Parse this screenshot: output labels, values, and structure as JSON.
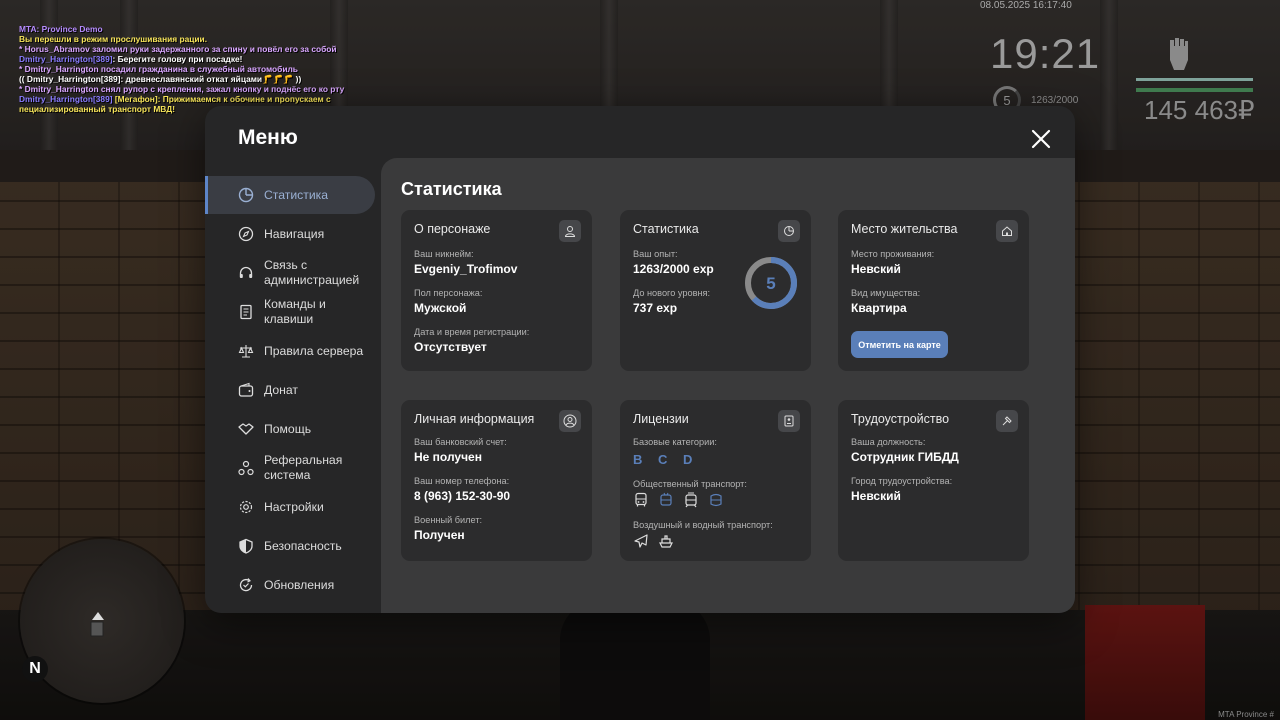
{
  "chat": {
    "lines": [
      {
        "name": "",
        "text": "MTA: Province Demo",
        "color": "#b68cff"
      },
      {
        "name": "",
        "text": "Вы перешли в режим прослушивания рации.",
        "color": "#f5e35a"
      },
      {
        "name": "",
        "text": " * Horus_Abramov заломил руки задержанного за спину и повёл его за собой",
        "color": "#d9a6ff"
      },
      {
        "name": "Dmitry_Harrington[389]",
        "text": ": Берегите голову при посадке!",
        "color": "#ffffff"
      },
      {
        "name": "",
        "text": " * Dmitry_Harrington посадил гражданина в служебный автомобиль",
        "color": "#d9a6ff"
      },
      {
        "name": "",
        "text": "(( Dmitry_Harrington[389]: древнеславянский откат яйцами🦵🦵🦵 ))",
        "color": "#ffffff"
      },
      {
        "name": "",
        "text": " * Dmitry_Harrington снял рупор с крепления, зажал кнопку и поднёс его ко рту",
        "color": "#d9a6ff"
      },
      {
        "name": "Dmitry_Harrington[389]",
        "text": " [Мегафон]: Прижимаемся к обочине и пропускаем с",
        "color": "#f5e35a"
      },
      {
        "name": "",
        "text": "пециализированный транспорт МВД!",
        "color": "#f5e35a"
      }
    ]
  },
  "hud": {
    "date": "08.05.2025 16:17:40",
    "time": "19:21",
    "level": "5",
    "exp": "1263/2000",
    "money": "145 463₽",
    "compass": "N",
    "watermark": "MTA Province #"
  },
  "menu": {
    "title": "Меню",
    "close_icon": "close-icon",
    "content_title": "Статистика",
    "sidebar": [
      {
        "label": "Статистика",
        "icon": "pie-chart-icon",
        "active": true
      },
      {
        "label": "Навигация",
        "icon": "compass-icon"
      },
      {
        "label": "Связь с администрацией",
        "icon": "headset-icon"
      },
      {
        "label": "Команды и клавиши",
        "icon": "document-icon"
      },
      {
        "label": "Правила сервера",
        "icon": "scales-icon"
      },
      {
        "label": "Донат",
        "icon": "wallet-icon"
      },
      {
        "label": "Помощь",
        "icon": "handshake-icon"
      },
      {
        "label": "Реферальная система",
        "icon": "referral-icon"
      },
      {
        "label": "Настройки",
        "icon": "gear-icon"
      },
      {
        "label": "Безопасность",
        "icon": "shield-icon"
      },
      {
        "label": "Обновления",
        "icon": "refresh-icon"
      }
    ]
  },
  "cards": {
    "character": {
      "title": "О персонаже",
      "nickname_label": "Ваш никнейм:",
      "nickname": "Evgeniy_Trofimov",
      "gender_label": "Пол персонажа:",
      "gender": "Мужской",
      "reg_label": "Дата и время регистрации:",
      "reg": "Отсутствует"
    },
    "stats": {
      "title": "Статистика",
      "exp_label": "Ваш опыт:",
      "exp": "1263/2000 exp",
      "next_label": "До нового уровня:",
      "next": "737 exp",
      "level": "5",
      "level_progress": 0.6315
    },
    "residence": {
      "title": "Место жительства",
      "place_label": "Место проживания:",
      "place": "Невский",
      "property_label": "Вид имущества:",
      "property": "Квартира",
      "map_button": "Отметить на карте"
    },
    "personal": {
      "title": "Личная информация",
      "bank_label": "Ваш банковский счет:",
      "bank": "Не получен",
      "phone_label": "Ваш номер телефона:",
      "phone": "8 (963) 152-30-90",
      "military_label": "Военный билет:",
      "military": "Получен"
    },
    "licenses": {
      "title": "Лицензии",
      "basic_label": "Базовые категории:",
      "basic": "B C D",
      "public_label": "Общественный транспорт:",
      "public_icons": [
        "bus-icon",
        "trolleybus-icon",
        "tram-icon",
        "metro-icon"
      ],
      "air_label": "Воздушный и водный транспорт:",
      "air_icons": [
        "airplane-icon",
        "ship-icon"
      ]
    },
    "job": {
      "title": "Трудоустройство",
      "position_label": "Ваша должность:",
      "position": "Сотрудник ГИБДД",
      "city_label": "Город трудоустройства:",
      "city": "Невский"
    }
  },
  "colors": {
    "accent": "#5a7fb9",
    "panel": "#262627",
    "content": "#3a3a3b",
    "card": "#2c2c2d"
  }
}
